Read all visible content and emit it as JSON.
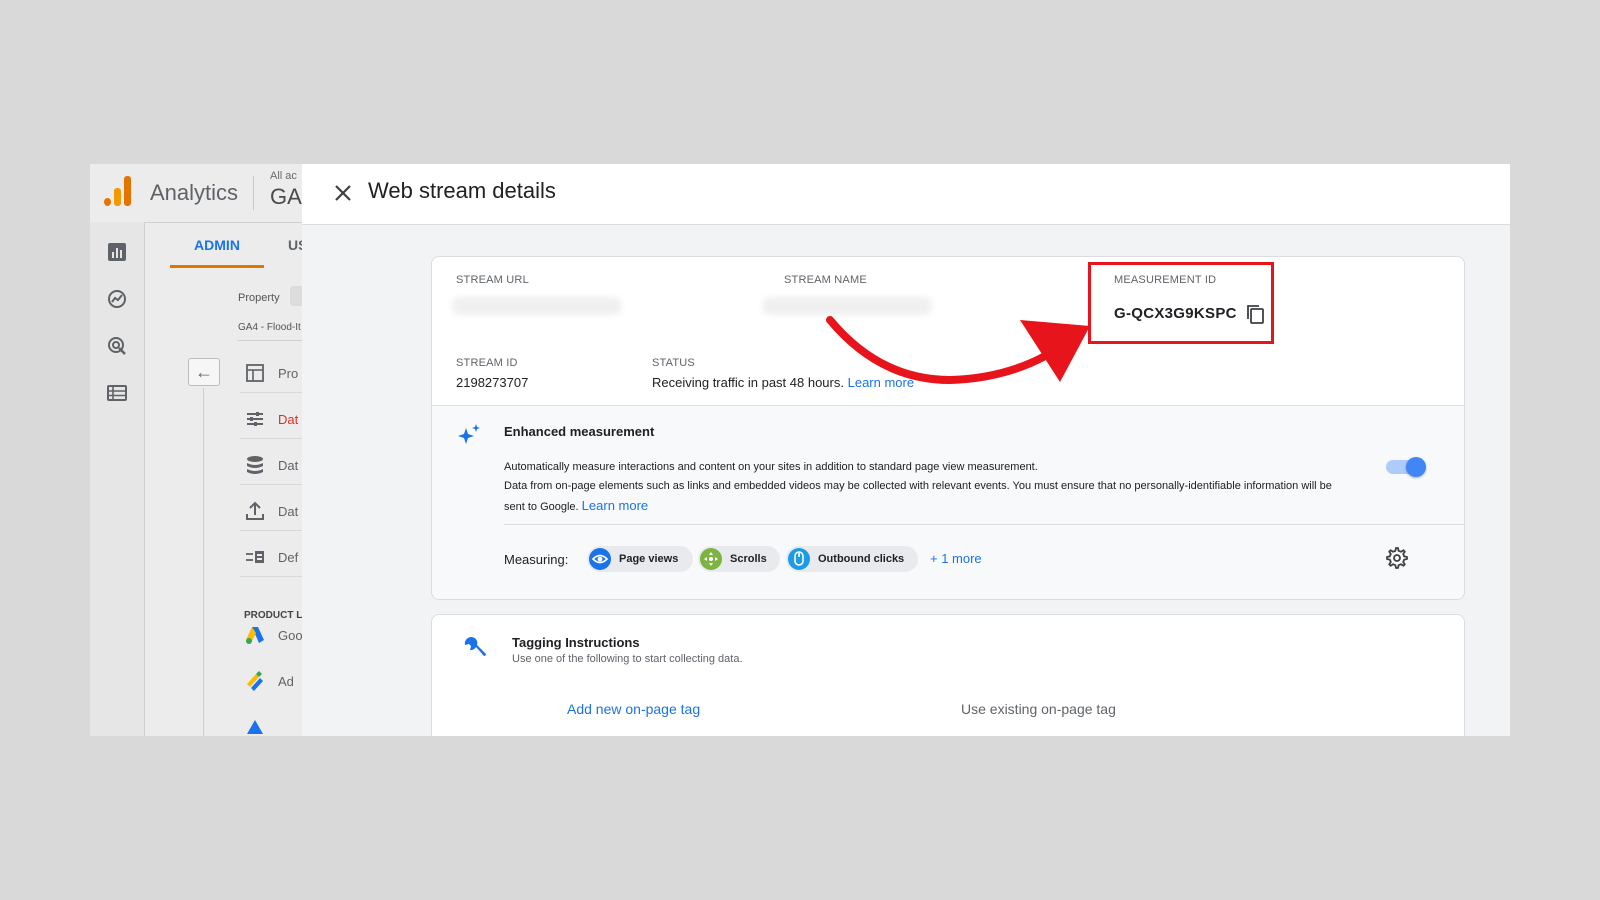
{
  "app": {
    "brand": "Analytics",
    "account_small": "All ac",
    "account_big": "GA",
    "tabs": {
      "admin": "ADMIN",
      "user": "US"
    },
    "property_label": "Property",
    "property_name": "GA4 - Flood-It",
    "menu": [
      {
        "label": "Pro",
        "icon": "property-settings-icon"
      },
      {
        "label": "Dat",
        "icon": "data-streams-icon",
        "active": true
      },
      {
        "label": "Dat",
        "icon": "data-settings-icon"
      },
      {
        "label": "Dat",
        "icon": "data-import-icon"
      },
      {
        "label": "Def",
        "icon": "custom-definitions-icon"
      }
    ],
    "product_links_heading": "PRODUCT L",
    "product_items": [
      {
        "label": "Goo",
        "icon": "google-ads-icon"
      },
      {
        "label": "Ad",
        "icon": "ad-manager-icon"
      }
    ]
  },
  "drawer": {
    "title": "Web stream details",
    "stream": {
      "url_label": "STREAM URL",
      "name_label": "STREAM NAME",
      "measurement_id_label": "MEASUREMENT ID",
      "measurement_id": "G-QCX3G9KSPC",
      "stream_id_label": "STREAM ID",
      "stream_id": "2198273707",
      "status_label": "STATUS",
      "status_text": "Receiving traffic in past 48 hours.",
      "status_link": "Learn more"
    },
    "enhanced": {
      "title": "Enhanced measurement",
      "line1": "Automatically measure interactions and content on your sites in addition to standard page view measurement.",
      "line2": "Data from on-page elements such as links and embedded videos may be collected with relevant events. You must ensure that no personally-identifiable information will be sent to Google.",
      "link": "Learn more",
      "measuring_label": "Measuring:",
      "chips": [
        "Page views",
        "Scrolls",
        "Outbound clicks"
      ],
      "more": "+ 1 more",
      "enabled": true
    },
    "tagging": {
      "title": "Tagging Instructions",
      "subtitle": "Use one of the following to start collecting data.",
      "option_new": "Add new on-page tag",
      "option_existing": "Use existing on-page tag"
    }
  },
  "colors": {
    "accent_blue": "#1a73e8",
    "annotation_red": "#e8141b",
    "tab_underline": "#e37400"
  }
}
